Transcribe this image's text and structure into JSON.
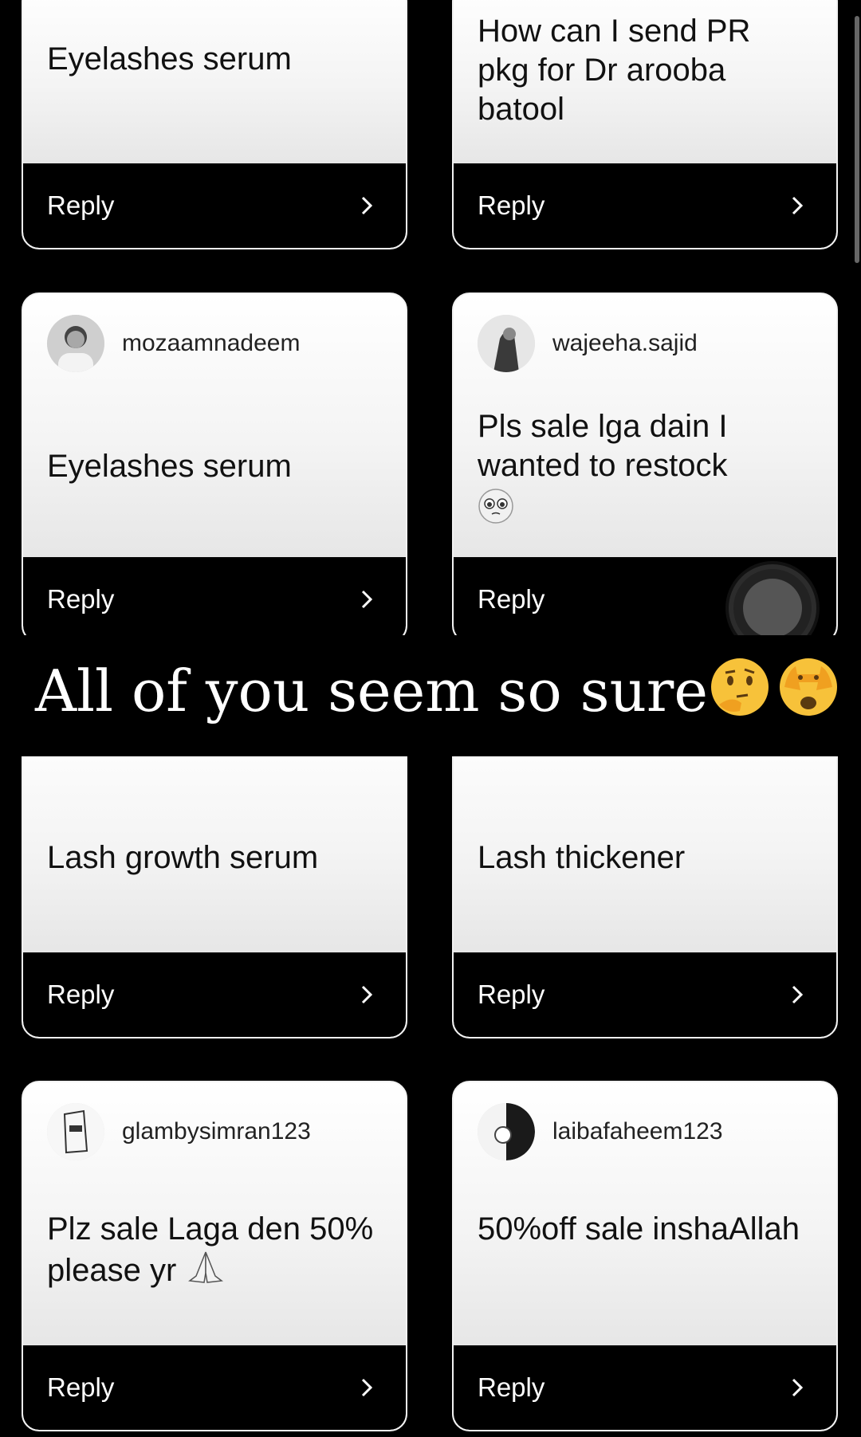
{
  "cards": [
    {
      "message": "Eyelashes serum",
      "reply_label": "Reply"
    },
    {
      "message": "How can I send PR pkg for Dr arooba batool",
      "reply_label": "Reply"
    },
    {
      "username": "mozaamnadeem",
      "message": "Eyelashes serum",
      "reply_label": "Reply"
    },
    {
      "username": "wajeeha.sajid",
      "message": "Pls sale lga dain I wanted to restock",
      "reply_label": "Reply"
    },
    {
      "message": "Lash growth serum",
      "reply_label": "Reply"
    },
    {
      "message": "Lash thickener",
      "reply_label": "Reply"
    },
    {
      "username": "glambysimran123",
      "message": "Plz sale Laga den 50% please yr",
      "reply_label": "Reply"
    },
    {
      "username": "laibafaheem123",
      "message": "50%off sale inshaAllah",
      "reply_label": "Reply"
    }
  ],
  "caption": {
    "text": "All of you seem so sure"
  },
  "icons": {
    "reply_chevron": "chevron-right-icon",
    "thinking_emoji": "thinking-face-emoji",
    "peeking_emoji": "face-with-open-eyes-and-hand-over-mouth-emoji",
    "pleading_emoji": "pleading-face-emoji",
    "praying_emoji": "folded-hands-emoji"
  }
}
